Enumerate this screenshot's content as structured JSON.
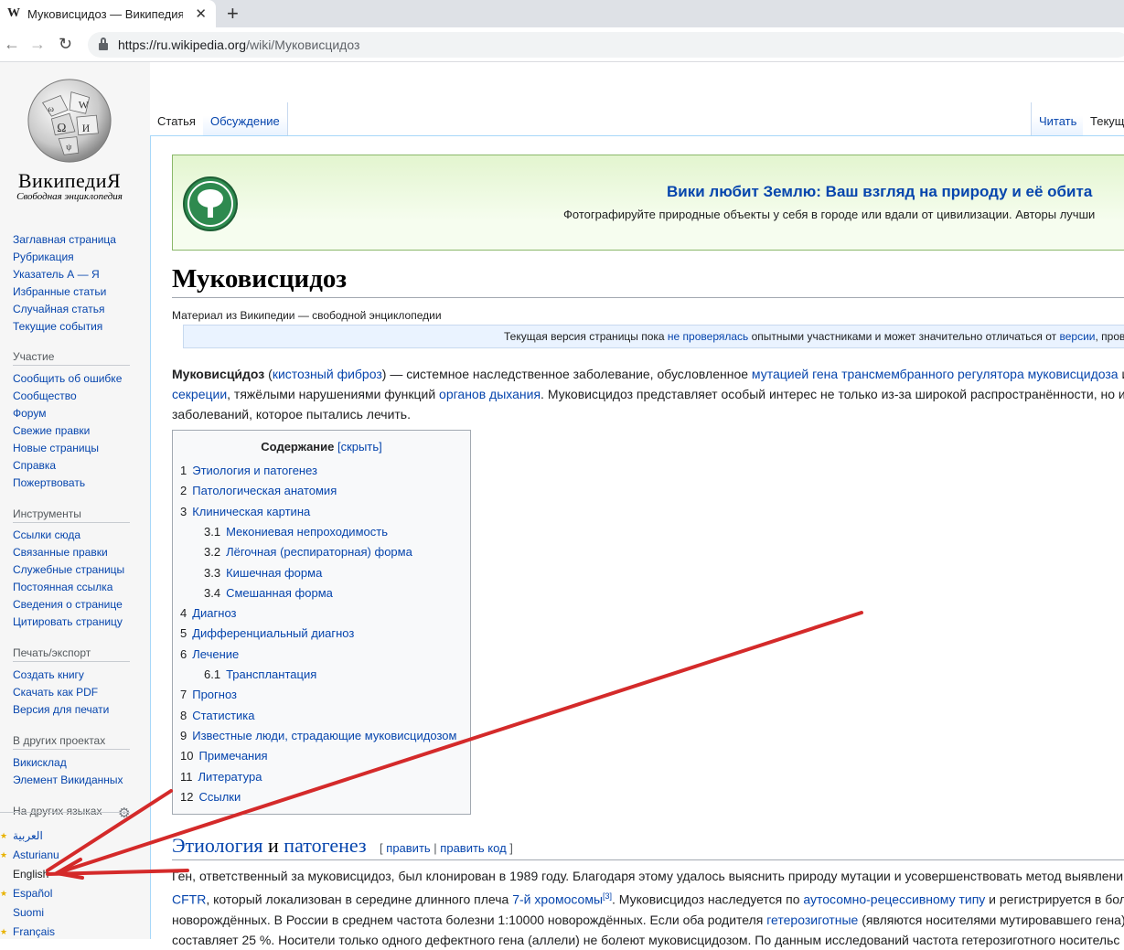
{
  "browser": {
    "tab_title": "Муковисцидоз — Википедия",
    "favicon": "W",
    "url_host": "https://ru.wikipedia.org",
    "url_path": "/wiki/Муковисцидоз"
  },
  "logo": {
    "name": "ВикипедиЯ",
    "tagline": "Свободная энциклопедия"
  },
  "sidebar": {
    "nav": [
      "Заглавная страница",
      "Рубрикация",
      "Указатель А — Я",
      "Избранные статьи",
      "Случайная статья",
      "Текущие события"
    ],
    "participation_heading": "Участие",
    "participation": [
      "Сообщить об ошибке",
      "Сообщество",
      "Форум",
      "Свежие правки",
      "Новые страницы",
      "Справка",
      "Пожертвовать"
    ],
    "tools_heading": "Инструменты",
    "tools": [
      "Ссылки сюда",
      "Связанные правки",
      "Служебные страницы",
      "Постоянная ссылка",
      "Сведения о странице",
      "Цитировать страницу"
    ],
    "print_heading": "Печать/экспорт",
    "print": [
      "Создать книгу",
      "Скачать как PDF",
      "Версия для печати"
    ],
    "projects_heading": "В других проектах",
    "projects": [
      "Викисклад",
      "Элемент Викиданных"
    ],
    "languages_heading": "На других языках",
    "languages": [
      "العربية",
      "Asturianu",
      "English",
      "Español",
      "Suomi",
      "Français"
    ]
  },
  "tabs": {
    "article": "Статья",
    "talk": "Обсуждение",
    "read": "Читать",
    "current": "Текущ"
  },
  "banner": {
    "title": "Вики любит Землю: Ваш взгляд на природу и её обита",
    "text": "Фотографируйте природные объекты у себя в городе или вдали от цивилизации. Авторы лучши"
  },
  "article": {
    "title": "Муковисцидоз",
    "subtitle": "Материал из Википедии — свободной энциклопедии",
    "flagged_prefix": "Текущая версия страницы пока ",
    "flagged_link1": "не проверялась",
    "flagged_mid": " опытными участниками и может значительно отличаться от ",
    "flagged_link2": "версии",
    "flagged_suffix": ", провер",
    "intro": {
      "bold": "Муковисци́доз",
      "l1_a": " (",
      "l1_link1": "кистозный фиброз",
      "l1_b": ") — системное наследственное заболевание, обусловленное ",
      "l1_link2": "мутацией",
      "l1_c": " ",
      "l1_link3": "гена трансмембранного регулятора муковисцидоза",
      "l1_d": " и",
      "l2_link1": "секреции",
      "l2_a": ", тяжёлыми нарушениями функций ",
      "l2_link2": "органов дыхания",
      "l2_b": ". Муковисцидоз представляет особый интерес не только из-за широкой распространённости, но и",
      "l3": "заболеваний, которое пытались лечить."
    }
  },
  "toc": {
    "title": "Содержание",
    "toggle": "[скрыть]",
    "items": [
      {
        "num": "1",
        "label": "Этиология и патогенез",
        "level": 1
      },
      {
        "num": "2",
        "label": "Патологическая анатомия",
        "level": 1
      },
      {
        "num": "3",
        "label": "Клиническая картина",
        "level": 1
      },
      {
        "num": "3.1",
        "label": "Мекониевая непроходимость",
        "level": 2
      },
      {
        "num": "3.2",
        "label": "Лёгочная (респираторная) форма",
        "level": 2
      },
      {
        "num": "3.3",
        "label": "Кишечная форма",
        "level": 2
      },
      {
        "num": "3.4",
        "label": "Смешанная форма",
        "level": 2
      },
      {
        "num": "4",
        "label": "Диагноз",
        "level": 1
      },
      {
        "num": "5",
        "label": "Дифференциальный диагноз",
        "level": 1
      },
      {
        "num": "6",
        "label": "Лечение",
        "level": 1
      },
      {
        "num": "6.1",
        "label": "Трансплантация",
        "level": 2
      },
      {
        "num": "7",
        "label": "Прогноз",
        "level": 1
      },
      {
        "num": "8",
        "label": "Статистика",
        "level": 1
      },
      {
        "num": "9",
        "label": "Известные люди, страдающие муковисцидозом",
        "level": 1
      },
      {
        "num": "10",
        "label": "Примечания",
        "level": 1
      },
      {
        "num": "11",
        "label": "Литература",
        "level": 1
      },
      {
        "num": "12",
        "label": "Ссылки",
        "level": 1
      }
    ]
  },
  "section": {
    "h_link1": "Этиология",
    "h_and": " и ",
    "h_link2": "патогенез",
    "edit_open": "[ ",
    "edit1": "править",
    "edit_sep": " | ",
    "edit2": "править код",
    "edit_close": " ]",
    "p1": "Ген, ответственный за муковисцидоз, был клонирован в 1989 году. Благодаря этому удалось выяснить природу мутации и усовершенствовать метод выявлени",
    "p2_link1": "CFTR",
    "p2_a": ", который локализован в середине длинного плеча ",
    "p2_link2": "7-й хромосомы",
    "p2_ref": "[3]",
    "p2_b": ". Муковисцидоз наследуется по ",
    "p2_link3": "аутосомно-рецессивному типу",
    "p2_c": " и регистрируется в бол",
    "p3_a": "новорождённых. В России в среднем частота болезни 1:10000 новорождённых. Если оба родителя ",
    "p3_link": "гетерозиготные",
    "p3_b": " (являются носителями мутировавшего гена)",
    "p4": "составляет 25 %. Носители только одного дефектного гена (аллели) не болеют муковисцидозом. По данным исследований частота гетерозиготного носительс"
  },
  "annotation": {
    "arrow_color": "#d42a2a"
  }
}
